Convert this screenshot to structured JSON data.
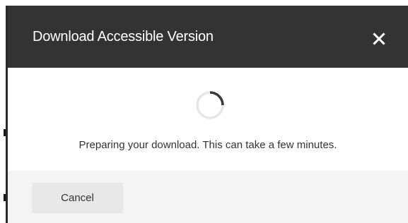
{
  "dialog": {
    "title": "Download Accessible Version",
    "close_icon": "close-icon",
    "message": "Preparing your download. This can take a few minutes.",
    "loading_icon": "spinner-icon",
    "cancel_label": "Cancel"
  },
  "colors": {
    "header_background": "#333333",
    "header_text": "#ffffff",
    "body_background": "#ffffff",
    "footer_background": "#f4f4f4",
    "button_background": "#e8e8e8",
    "text": "#333333",
    "spinner_track": "#e6e6e6",
    "spinner_arc": "#3a3a3a"
  }
}
